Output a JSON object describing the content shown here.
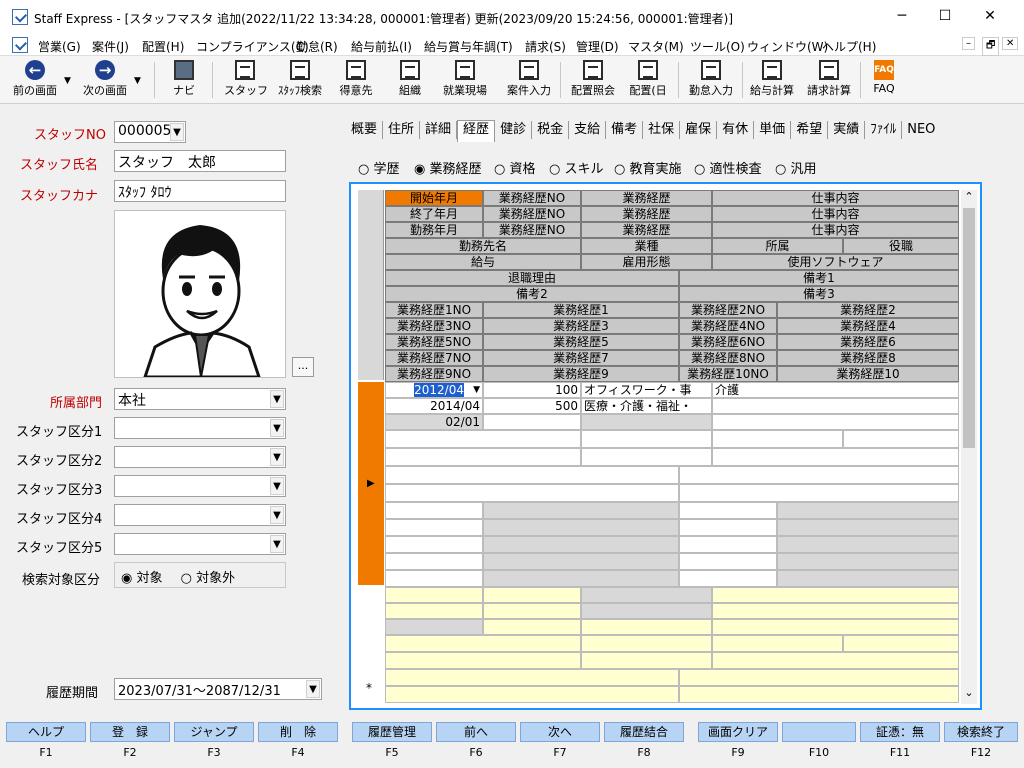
{
  "window": {
    "title": "Staff Express - [スタッフマスタ 追加(2022/11/22 13:34:28, 000001:管理者) 更新(2023/09/20 15:24:56, 000001:管理者)]",
    "min": "─",
    "max": "☐",
    "close": "✕"
  },
  "menu": [
    "営業(G)",
    "案件(J)",
    "配置(H)",
    "コンプライアンス(C)",
    "勤怠(R)",
    "給与前払(I)",
    "給与賞与年調(T)",
    "請求(S)",
    "管理(D)",
    "マスタ(M)",
    "ツール(O)",
    "ウィンドウ(W)",
    "ヘルプ(H)"
  ],
  "mdi": [
    "–",
    "🗗",
    "✕"
  ],
  "toolbar": [
    "前の画面",
    "次の画面",
    "ナビ",
    "スタッフ",
    "ｽﾀｯﾌ検索",
    "得意先",
    "組織",
    "就業現場",
    "案件入力",
    "配置照会",
    "配置(日",
    "勤怠入力",
    "給与計算",
    "請求計算",
    "FAQ"
  ],
  "toolbar_icons": [
    "back-arrow-icon",
    "forward-arrow-icon",
    "keyboard-icon",
    "person-icon",
    "person-search-icon",
    "building-icon",
    "building-icon",
    "building-icon",
    "doc-arrow-icon",
    "people-icon",
    "people-icon",
    "form-icon",
    "calculator-icon",
    "calculator-icon",
    "faq-icon"
  ],
  "form": {
    "staff_no_label": "スタッフNO",
    "staff_no": "000005",
    "staff_name_label": "スタッフ氏名",
    "staff_name": "スタッフ　太郎",
    "staff_kana_label": "スタッフカナ",
    "staff_kana": "ｽﾀｯﾌ ﾀﾛｳ",
    "photo_button": "...",
    "dept_label": "所属部門",
    "dept": "本社",
    "kubun": [
      "スタッフ区分1",
      "スタッフ区分2",
      "スタッフ区分3",
      "スタッフ区分4",
      "スタッフ区分5"
    ],
    "search_label": "検索対象区分",
    "search_opt1": "対象",
    "search_opt2": "対象外",
    "period_label": "履歴期間",
    "period": "2023/07/31～2087/12/31"
  },
  "tabs": [
    "概要",
    "住所",
    "詳細",
    "経歴",
    "健診",
    "税金",
    "支給",
    "備考",
    "社保",
    "雇保",
    "有休",
    "単価",
    "希望",
    "実績",
    "ﾌｧｲﾙ",
    "NEO"
  ],
  "radios": [
    "学歴",
    "業務経歴",
    "資格",
    "スキル",
    "教育実施",
    "適性検査",
    "汎用"
  ],
  "grid": {
    "h1": [
      "開始年月",
      "業務経歴NO",
      "業務経歴",
      "仕事内容"
    ],
    "h2": [
      "終了年月",
      "業務経歴NO",
      "業務経歴",
      "仕事内容"
    ],
    "h3": [
      "勤務年月",
      "業務経歴NO",
      "業務経歴",
      "仕事内容"
    ],
    "h4": [
      "勤務先名",
      "業種",
      "所属",
      "役職"
    ],
    "h5": [
      "給与",
      "雇用形態",
      "使用ソフトウェア"
    ],
    "h6": [
      "退職理由",
      "備考1"
    ],
    "h7": [
      "備考2",
      "備考3"
    ],
    "h8": [
      "業務経歴1NO",
      "業務経歴1",
      "業務経歴2NO",
      "業務経歴2"
    ],
    "h9": [
      "業務経歴3NO",
      "業務経歴3",
      "業務経歴4NO",
      "業務経歴4"
    ],
    "h10": [
      "業務経歴5NO",
      "業務経歴5",
      "業務経歴6NO",
      "業務経歴6"
    ],
    "h11": [
      "業務経歴7NO",
      "業務経歴7",
      "業務経歴8NO",
      "業務経歴8"
    ],
    "h12": [
      "業務経歴9NO",
      "業務経歴9",
      "業務経歴10NO",
      "業務経歴10"
    ],
    "r1": [
      "2012/04",
      "100",
      "オフィスワーク・事",
      "介護"
    ],
    "r2": [
      "2014/04",
      "500",
      "医療・介護・福祉・"
    ],
    "r3": [
      "02/01"
    ],
    "row_arrow": "▶",
    "new_row": "*",
    "scroll_up": "⌃",
    "scroll_down": "⌄"
  },
  "fkeys": [
    {
      "label": "ヘルプ",
      "key": "F1"
    },
    {
      "label": "登　録",
      "key": "F2"
    },
    {
      "label": "ジャンプ",
      "key": "F3"
    },
    {
      "label": "削　除",
      "key": "F4"
    },
    {
      "label": "履歴管理",
      "key": "F5"
    },
    {
      "label": "前へ",
      "key": "F6"
    },
    {
      "label": "次へ",
      "key": "F7"
    },
    {
      "label": "履歴結合",
      "key": "F8"
    },
    {
      "label": "画面クリア",
      "key": "F9"
    },
    {
      "label": "",
      "key": "F10"
    },
    {
      "label": "証憑：無",
      "key": "F11"
    },
    {
      "label": "検索終了",
      "key": "F12"
    }
  ]
}
